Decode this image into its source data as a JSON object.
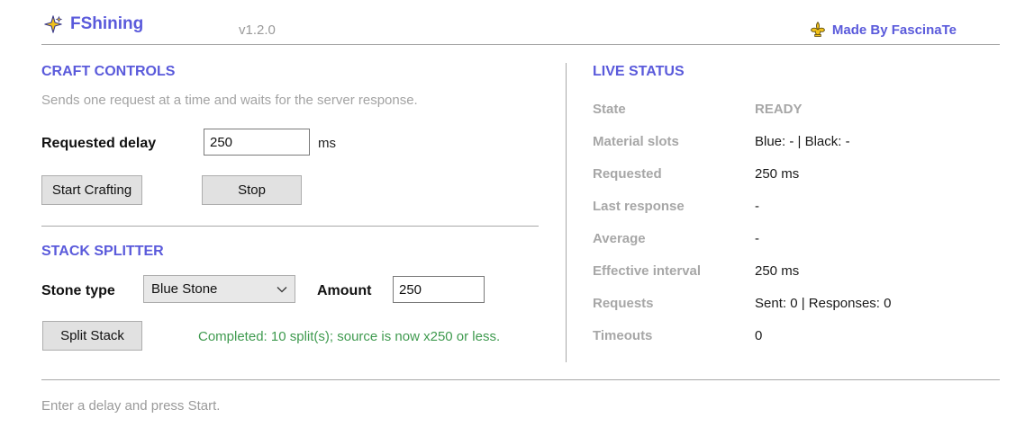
{
  "header": {
    "title": "FShining",
    "version": "v1.2.0",
    "credit": "Made By FascinaTe"
  },
  "craft": {
    "heading": "CRAFT CONTROLS",
    "subtitle": "Sends one request at a time and waits for the server response.",
    "delay_label": "Requested delay",
    "delay_value": "250",
    "delay_unit": "ms",
    "start_label": "Start Crafting",
    "stop_label": "Stop"
  },
  "splitter": {
    "heading": "STACK SPLITTER",
    "stone_label": "Stone type",
    "stone_selected": "Blue Stone",
    "amount_label": "Amount",
    "amount_value": "250",
    "split_label": "Split Stack",
    "result": "Completed: 10 split(s); source is now x250 or less."
  },
  "status": {
    "heading": "LIVE STATUS",
    "rows": [
      {
        "key": "State",
        "value": "READY"
      },
      {
        "key": "Material slots",
        "value": "Blue: - | Black: -"
      },
      {
        "key": "Requested",
        "value": "250 ms"
      },
      {
        "key": "Last response",
        "value": "-"
      },
      {
        "key": "Average",
        "value": "-"
      },
      {
        "key": "Effective interval",
        "value": "250 ms"
      },
      {
        "key": "Requests",
        "value": "Sent: 0 | Responses: 0"
      },
      {
        "key": "Timeouts",
        "value": "0"
      }
    ]
  },
  "footer": {
    "message": "Enter a delay and press Start."
  },
  "colors": {
    "accent": "#5a5adb",
    "success": "#3f9a4f",
    "muted": "#a7a7a7"
  },
  "icons": {
    "title_icon": "sparkle-star-icon",
    "credit_icon": "fleur-de-lis-icon",
    "select_icon": "chevron-down-icon"
  }
}
